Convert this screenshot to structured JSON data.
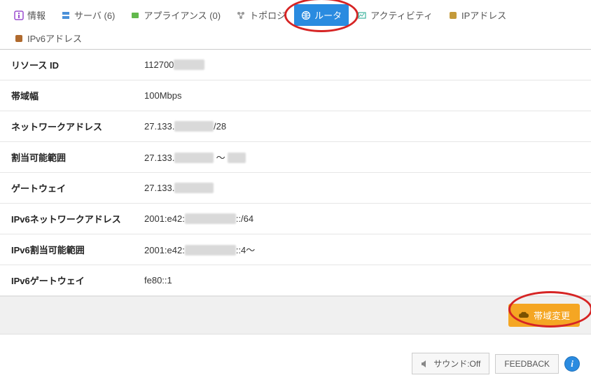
{
  "tabs": {
    "info": "情報",
    "server": "サーバ (6)",
    "appliance": "アプライアンス (0)",
    "topology": "トポロジ",
    "router": "ルータ",
    "activity": "アクティビティ",
    "ip": "IPアドレス",
    "ipv6": "IPv6アドレス"
  },
  "rows": {
    "resource_id": {
      "label": "リソース ID",
      "prefix": "112700",
      "masked": "XXXXX"
    },
    "bandwidth": {
      "label": "帯域幅",
      "value": "100Mbps"
    },
    "network_addr": {
      "label": "ネットワークアドレス",
      "prefix": "27.133.",
      "masked": "XXX.XXX",
      "suffix": "/28"
    },
    "assignable": {
      "label": "割当可能範囲",
      "prefix": "27.133.",
      "masked": "XXX.XXX",
      "mid": " ～ ",
      "masked2": "XXX"
    },
    "gateway": {
      "label": "ゲートウェイ",
      "prefix": "27.133.",
      "masked": "XXX.XXX"
    },
    "ipv6_network": {
      "label": "IPv6ネットワークアドレス",
      "prefix": "2001:e42:",
      "masked": "XXXX:XXXX",
      "suffix": "::/64"
    },
    "ipv6_assignable": {
      "label": "IPv6割当可能範囲",
      "prefix": "2001:e42:",
      "masked": "XXXX:XXXX",
      "suffix": "::4～"
    },
    "ipv6_gateway": {
      "label": "IPv6ゲートウェイ",
      "value": "fe80::1"
    }
  },
  "actions": {
    "change_bandwidth": "帯域変更"
  },
  "footer": {
    "sound": "サウンド:Off",
    "feedback": "FEEDBACK"
  }
}
